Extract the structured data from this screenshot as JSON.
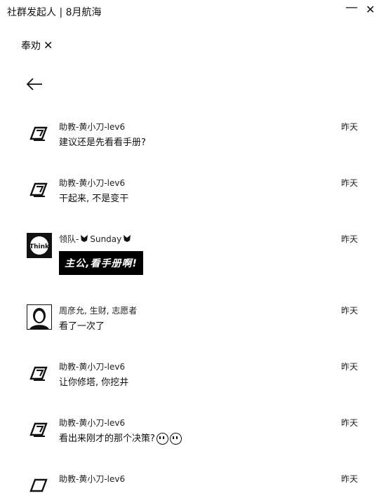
{
  "window": {
    "title": "社群发起人 | 8月航海",
    "minimize_label": "—",
    "close_label": "✕"
  },
  "filter": {
    "tag_label": "奉劝",
    "remove_label": "✕"
  },
  "messages": [
    {
      "author": "助教-黄小刀-lev6",
      "time": "昨天",
      "text": "建议还是先看看手册?",
      "avatar_icon": "brand-logo-icon"
    },
    {
      "author": "助教-黄小刀-lev6",
      "time": "昨天",
      "text": "干起来, 不是变干",
      "avatar_icon": "brand-logo-icon"
    },
    {
      "author": "领队-",
      "author_name": "Sunday",
      "time": "昨天",
      "sticker_text": "主公,看手册啊!",
      "avatar_icon": "think-avatar-icon"
    },
    {
      "author": "周彦允, 生财, 志愿者",
      "time": "昨天",
      "text": "看了一次了",
      "avatar_icon": "portrait-avatar-icon"
    },
    {
      "author": "助教-黄小刀-lev6",
      "time": "昨天",
      "text": "让你修塔, 你挖井",
      "avatar_icon": "brand-logo-icon"
    },
    {
      "author": "助教-黄小刀-lev6",
      "time": "昨天",
      "text": "看出来刚才的那个决策?",
      "avatar_icon": "brand-logo-icon"
    },
    {
      "author": "助教-黄小刀-lev6",
      "time": "昨天",
      "avatar_icon": "brand-logo-icon"
    }
  ]
}
